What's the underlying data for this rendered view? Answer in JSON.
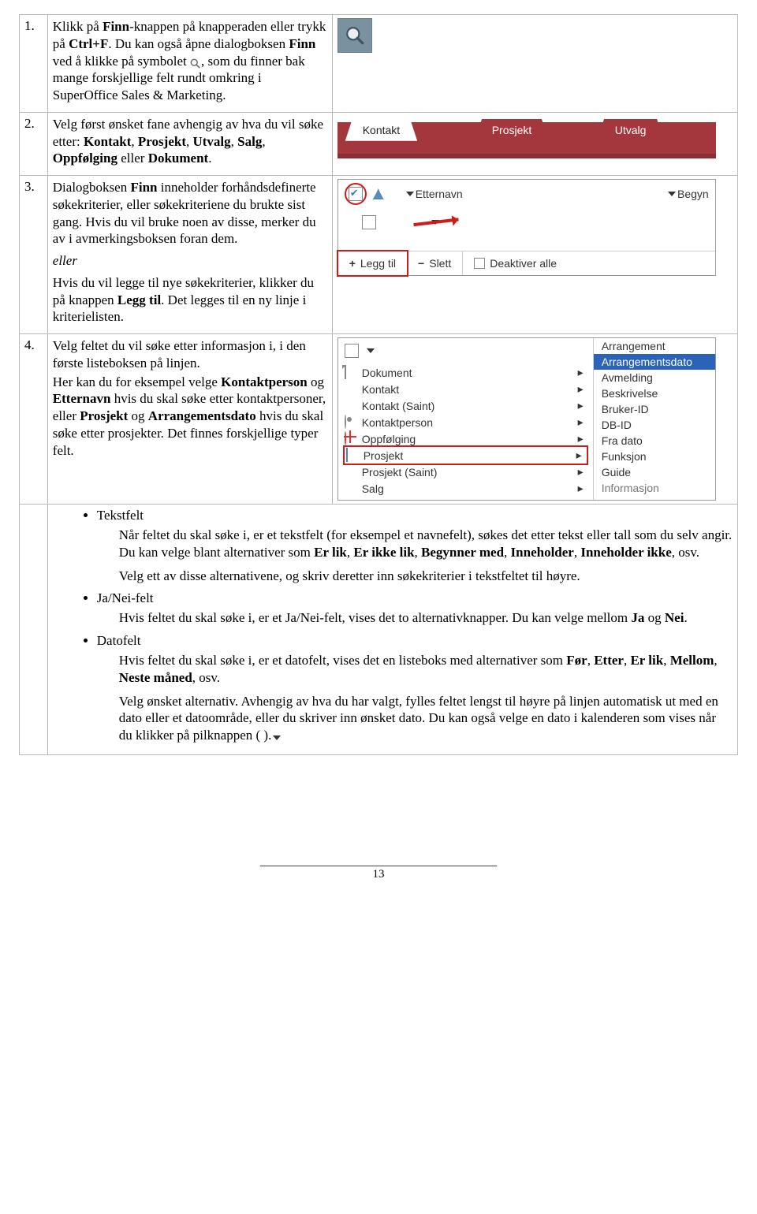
{
  "page_number": "13",
  "rows": [
    {
      "num": "1.",
      "p1a": "Klikk på ",
      "p1b": "Finn",
      "p1c": "-knappen på knapperaden eller trykk på ",
      "p1d": "Ctrl+F",
      "p1e": ". Du kan også åpne dialogboksen ",
      "p1f": "Finn",
      "p1g": " ved å klikke på symbolet ",
      "p1h": ", som du finner bak mange forskjellige felt rundt omkring i SuperOffice Sales & Marketing."
    },
    {
      "num": "2.",
      "p1a": "Velg først ønsket fane avhengig av hva du vil søke etter: ",
      "p1b": "Kontakt",
      "p1c": ", ",
      "p1d": "Prosjekt",
      "p1e": ", ",
      "p1f": "Utvalg",
      "p1g": ", ",
      "p1h": "Salg",
      "p1i": ", ",
      "p1j": "Oppfølging",
      "p1k": " eller ",
      "p1l": "Dokument",
      "p1m": ".",
      "tabs": {
        "t1": "Kontakt",
        "t2": "Prosjekt",
        "t3": "Utvalg"
      }
    },
    {
      "num": "3.",
      "p1a": "Dialogboksen ",
      "p1b": "Finn",
      "p1c": " inneholder forhåndsdefinerte søkekriterier, eller søkekriteriene du brukte sist gang. Hvis du vil bruke noen av disse, merker du av i avmerkingsboksen foran dem.",
      "eller": "eller",
      "p2a": "Hvis du vil legge til nye søkekriterier, klikker du på knappen ",
      "p2b": "Legg til",
      "p2c": ". Det legges til en ny linje i kriterielisten.",
      "panel": {
        "etternavn": "Etternavn",
        "begyn": "Begyn",
        "add": "Legg til",
        "del": "Slett",
        "deact": "Deaktiver alle"
      }
    },
    {
      "num": "4.",
      "p1a": "Velg feltet du vil søke etter informasjon i, i den første listeboksen på linjen.",
      "p1b": "Her kan du for eksempel velge ",
      "p1c": "Kontaktperson",
      "p1d": " og ",
      "p1e": "Etternavn",
      "p1f": " hvis du skal søke etter kontaktpersoner, eller ",
      "p1g": "Prosjekt",
      "p1h": " og ",
      "p1i": "Arrangementsdato",
      "p1j": " hvis du skal søke etter prosjekter. Det finnes forskjellige typer felt.",
      "menu": {
        "m1": "Dokument",
        "m2": "Kontakt",
        "m3": "Kontakt (Saint)",
        "m4": "Kontaktperson",
        "m5": "Oppfølging",
        "m6": "Prosjekt",
        "m7": "Prosjekt (Saint)",
        "m8": "Salg"
      },
      "sub": {
        "s1": "Arrangement",
        "s2": "Arrangementsdato",
        "s3": "Avmelding",
        "s4": "Beskrivelse",
        "s5": "Bruker-ID",
        "s6": "DB-ID",
        "s7": "Fra dato",
        "s8": "Funksjon",
        "s9": "Guide",
        "s10": "Informasjon"
      }
    }
  ],
  "bullets": {
    "b1": "Tekstfelt",
    "b1d1a": "Når feltet du skal søke i, er et tekstfelt (for eksempel et navnefelt), søkes det etter tekst eller tall som du selv angir. Du kan velge blant alternativer som ",
    "b1d1_erlik": "Er lik",
    "b1d1_c1": ", ",
    "b1d1_eikkelik": "Er ikke lik",
    "b1d1_c2": ", ",
    "b1d1_beg": "Begynner med",
    "b1d1_c3": ", ",
    "b1d1_inn": "Inneholder",
    "b1d1_c4": ", ",
    "b1d1_innikke": "Inneholder ikke",
    "b1d1_osv": ", osv.",
    "b1d2": "Velg ett av disse alternativene, og skriv deretter inn søkekriterier i tekstfeltet til høyre.",
    "b2": "Ja/Nei-felt",
    "b2d1a": "Hvis feltet du skal søke i, er et Ja/Nei-felt, vises det to alternativknapper. Du kan velge mellom ",
    "b2d1_ja": "Ja",
    "b2d1_og": " og ",
    "b2d1_nei": "Nei",
    "b2d1_dot": ".",
    "b3": "Datofelt",
    "b3d1a": "Hvis feltet du skal søke i, er et datofelt, vises det en listeboks med alternativer som ",
    "b3d1_for": "Før",
    "b3d1_c1": ", ",
    "b3d1_ett": "Etter",
    "b3d1_c2": ", ",
    "b3d1_erl": "Er lik",
    "b3d1_c3": ", ",
    "b3d1_mel": "Mellom",
    "b3d1_c4": ", ",
    "b3d1_nm": "Neste måned",
    "b3d1_osv": ", osv.",
    "b3d2": "Velg ønsket alternativ. Avhengig av hva du har valgt, fylles feltet lengst til høyre på linjen automatisk ut med en dato eller et datoområde, eller du skriver inn ønsket dato. Du kan også velge en dato i kalenderen som vises når du klikker på pilknappen (   )."
  }
}
